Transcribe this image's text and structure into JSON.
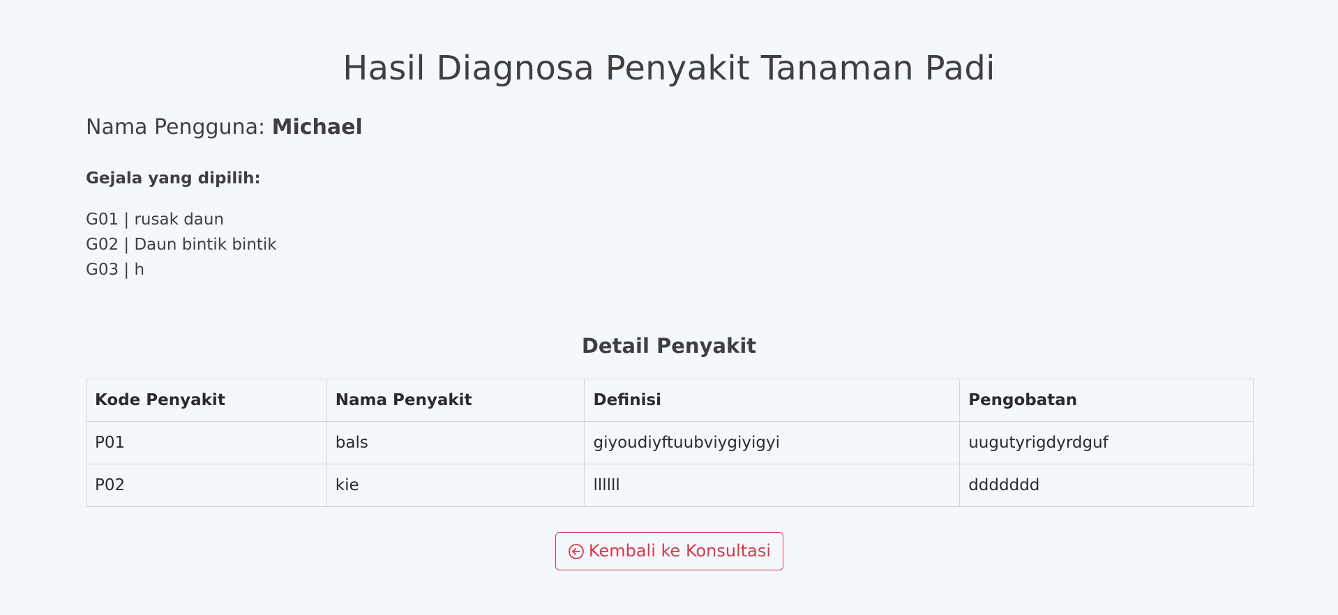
{
  "page": {
    "title": "Hasil Diagnosa Penyakit Tanaman Padi"
  },
  "user": {
    "label": "Nama Pengguna:",
    "name": "Michael"
  },
  "symptoms": {
    "heading": "Gejala yang dipilih:",
    "items": [
      "G01 | rusak daun",
      "G02 | Daun bintik bintik",
      "G03 | h"
    ]
  },
  "detail": {
    "title": "Detail Penyakit",
    "columns": [
      "Kode Penyakit",
      "Nama Penyakit",
      "Definisi",
      "Pengobatan"
    ],
    "rows": [
      [
        "P01",
        "bals",
        "giyoudiyftuubviygiyigyi",
        "uugutyrigdyrdguf"
      ],
      [
        "P02",
        "kie",
        "llllll",
        "ddddddd"
      ]
    ]
  },
  "actions": {
    "back_label": "Kembali ke Konsultasi",
    "back_icon": "circle-arrow-left-icon"
  },
  "colors": {
    "background": "#f4f7fc",
    "text": "#3f3f3f",
    "accent": "#d63a4a",
    "border": "#d3d6da"
  }
}
